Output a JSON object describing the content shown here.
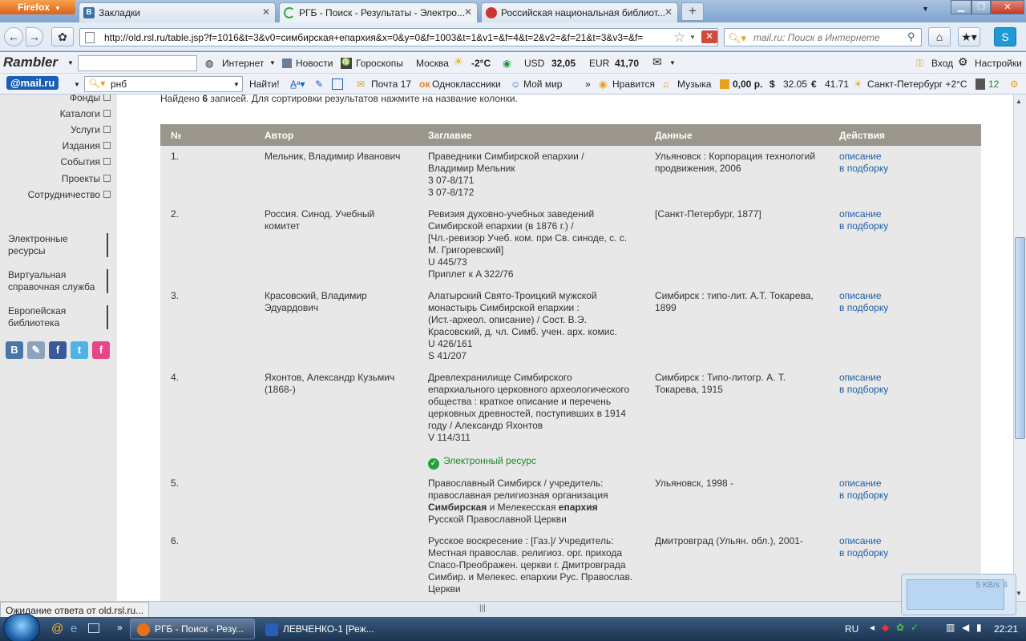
{
  "browser": {
    "app_button": "Firefox",
    "tabs": [
      {
        "label": "Закладки"
      },
      {
        "label": "РГБ - Поиск - Результаты - Электро..."
      },
      {
        "label": "Российская национальная библиот..."
      }
    ],
    "url": "http://old.rsl.ru/table.jsp?f=1016&t=3&v0=симбирская+епархия&x=0&y=0&f=1003&t=1&v1=&f=4&t=2&v2=&f=21&t=3&v3=&f=",
    "search_placeholder": "mail.ru: Поиск в Интернете"
  },
  "rambler_bar": {
    "logo": "Rambler",
    "search_value": "",
    "internet": "Интернет",
    "news": "Новости",
    "horoscopes": "Гороскопы",
    "city": "Москва",
    "temp": "-2°C",
    "usd_label": "USD",
    "usd_value": "32,05",
    "eur_label": "EUR",
    "eur_value": "41,70",
    "login": "Вход",
    "settings": "Настройки"
  },
  "mail_bar": {
    "logo": "@mail.ru",
    "search_value": "рнб",
    "find_button": "Найти!",
    "mail": "Почта 17",
    "ok": "Одноклассники",
    "myworld": "Мой мир",
    "more": "»",
    "likes": "Нравится",
    "music": "Музыка",
    "money": "0,00 р.",
    "usd": "32.05",
    "eur": "41.71",
    "weather": "Санкт-Петербург +2°C",
    "count": "12"
  },
  "sidebar": {
    "nav": [
      "Фонды",
      "Каталоги",
      "Услуги",
      "Издания",
      "События",
      "Проекты",
      "Сотрудничество"
    ],
    "resources": [
      "Электронные ресурсы",
      "Виртуальная справочная служба",
      "Европейская библиотека"
    ],
    "social": [
      {
        "icon": "vkontakte-icon",
        "glyph": "В",
        "color": "#4a76a8"
      },
      {
        "icon": "livejournal-icon",
        "glyph": "✎",
        "color": "#8ca3bd"
      },
      {
        "icon": "facebook-icon",
        "glyph": "f",
        "color": "#3b5998"
      },
      {
        "icon": "twitter-icon",
        "glyph": "t",
        "color": "#4fb3e6"
      },
      {
        "icon": "odnoklassniki-icon",
        "glyph": "f",
        "color": "#e8458b"
      }
    ]
  },
  "results": {
    "found_prefix": "Найдено ",
    "found_count": "6",
    "found_suffix": " записей. Для сортировки результатов нажмите на название колонки.",
    "columns": [
      "№",
      "Автор",
      "Заглавие",
      "Данные",
      "Действия"
    ],
    "rows": [
      {
        "num": "1.",
        "author": "Мельник, Владимир Иванович",
        "title": [
          "Праведники Симбирской епархии /",
          "Владимир Мельник",
          "3 07-8/171",
          "3 07-8/172"
        ],
        "data": "Ульяновск : Корпорация технологий продвижения, 2006",
        "extra": ""
      },
      {
        "num": "2.",
        "author": "Россия. Синод. Учебный комитет",
        "title": [
          "Ревизия духовно-учебных заведений",
          "Симбирской епархии (в 1876 г.) /",
          "[Чл.-ревизор Учеб. ком. при Св. синоде, с. с.",
          "М. Григоревский]",
          "U 445/73",
          "Приплет к A 322/76"
        ],
        "data": "[Санкт-Петербург, 1877]",
        "extra": ""
      },
      {
        "num": "3.",
        "author": "Красовский, Владимир Эдуардович",
        "title": [
          "Алатырский Свято-Троицкий мужской",
          "монастырь Симбирской епархии :",
          "(Ист.-археол. описание) / Сост. В.Э.",
          "Красовский, д. чл. Симб. учен. арх. комис.",
          "U 426/161",
          "S 41/207"
        ],
        "data": "Симбирск : типо-лит. А.Т. Токарева, 1899",
        "extra": ""
      },
      {
        "num": "4.",
        "author": "Яхонтов, Александр Кузьмич (1868-)",
        "title": [
          "Древлехранилище Симбирского",
          "епархиального церковного археологического",
          "общества : краткое описание и перечень",
          "церковных древностей, поступивших в 1914",
          "году / Александр Яхонтов",
          "V 114/311"
        ],
        "data": "Симбирск : Типо-литогр. А. Т. Токарева, 1915",
        "extra": "Электронный ресурс"
      },
      {
        "num": "5.",
        "author": "",
        "title_html": [
          "Православный Симбирск / учредитель:",
          "православная религиозная организация",
          "<b>Симбирская</b> и Мелекесская <b>епархия</b>",
          "Русской Православной Церкви"
        ],
        "data": "Ульяновск, 1998 -",
        "extra": ""
      },
      {
        "num": "6.",
        "author": "",
        "title": [
          "Русское воскресение : [Газ.]/ Учредитель:",
          "Местная православ. религиоз. орг. прихода",
          "Спасо-Преображен. церкви г. Дмитровграда",
          "Симбир. и Мелекес. епархии Рус. Православ.",
          "Церкви"
        ],
        "data": "Дмитровград (Ульян. обл.), 2001-",
        "extra": ""
      }
    ],
    "action_describe": "описание",
    "action_collect": "в подборку"
  },
  "status": {
    "text": "Ожидание ответа от old.rsl.ru...",
    "speed": "5 KB/s"
  },
  "taskbar": {
    "tasks": [
      "РГБ - Поиск - Резу...",
      "ЛЕВЧЕНКО-1 [Реж..."
    ],
    "lang": "RU",
    "clock": "22:21"
  }
}
